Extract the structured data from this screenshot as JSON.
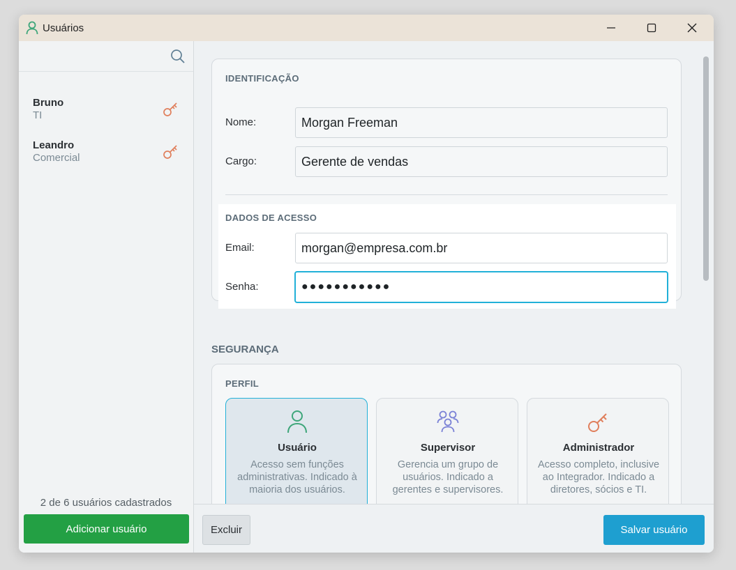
{
  "window": {
    "title": "Usuários",
    "title_icon": "person-icon"
  },
  "sidebar": {
    "search_icon": "search-icon",
    "users": [
      {
        "name": "Bruno",
        "role": "TI",
        "icon": "key-icon"
      },
      {
        "name": "Leandro",
        "role": "Comercial",
        "icon": "key-icon"
      }
    ],
    "count_text": "2 de 6 usuários cadastrados",
    "add_button": "Adicionar usuário"
  },
  "identification": {
    "section_label": "IDENTIFICAÇÃO",
    "name_label": "Nome:",
    "name_value": "Morgan Freeman",
    "role_label": "Cargo:",
    "role_value": "Gerente de vendas"
  },
  "access": {
    "section_label": "DADOS DE ACESSO",
    "email_label": "Email:",
    "email_value": "morgan@empresa.com.br",
    "password_label": "Senha:",
    "password_value": "●●●●●●●●●●●"
  },
  "security": {
    "title": "SEGURANÇA",
    "profile_label": "PERFIL",
    "profiles": [
      {
        "title": "Usuário",
        "description": "Acesso sem funções administrativas. Indicado à maioria dos usuários.",
        "icon": "person-icon",
        "selected": true
      },
      {
        "title": "Supervisor",
        "description": "Gerencia um grupo de usuários. Indicado a gerentes e supervisores.",
        "icon": "group-icon",
        "selected": false
      },
      {
        "title": "Administrador",
        "description": "Acesso completo, inclusive ao Integrador. Indicado a diretores, sócios e TI.",
        "icon": "key-icon",
        "selected": false
      }
    ]
  },
  "footer": {
    "delete_button": "Excluir",
    "save_button": "Salvar usuário"
  },
  "colors": {
    "accent": "#21b0d8",
    "add_button": "#23a044",
    "save_button": "#1e9fd0",
    "user_icon": "#3ea67a",
    "group_icon": "#7b82d6",
    "key_icon": "#e07f5c"
  }
}
